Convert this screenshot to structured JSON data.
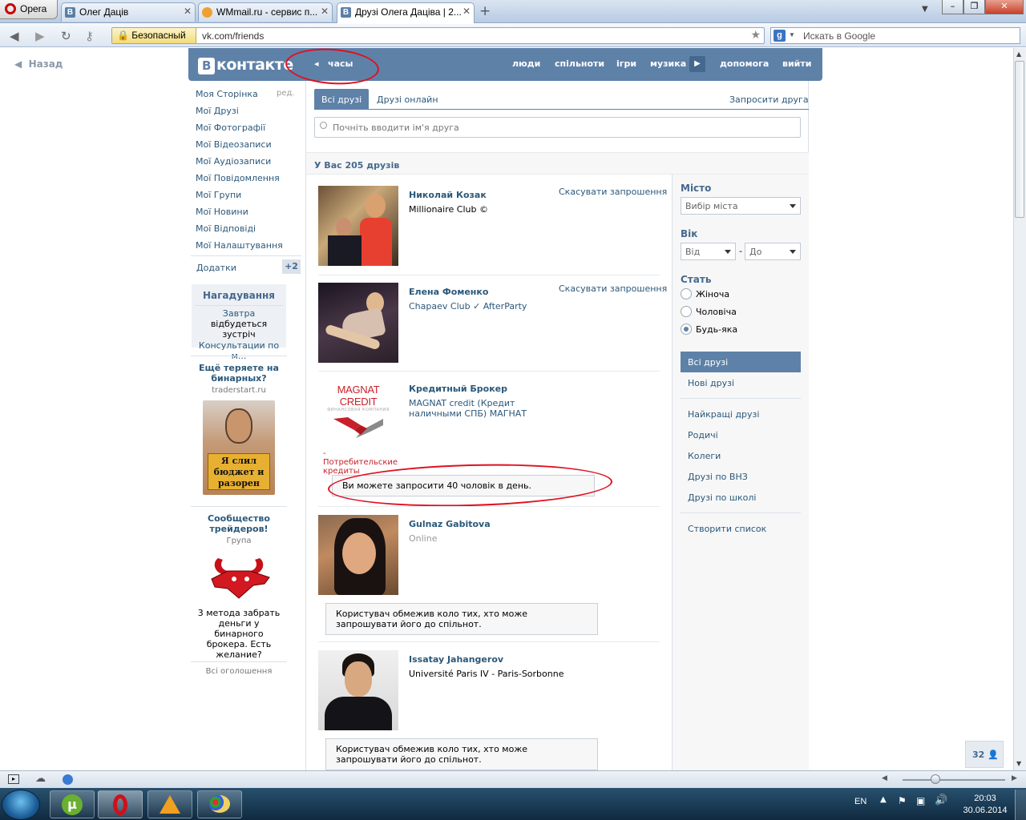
{
  "browser": {
    "menu_label": "Opera",
    "tabs": [
      {
        "label": "Олег Дацiв",
        "icon": "В"
      },
      {
        "label": "WMmail.ru - сервис п...",
        "icon": ""
      },
      {
        "label": "Друзi Олега Дацiва | 2...",
        "icon": "В"
      }
    ],
    "security_label": "Безопасный",
    "url": "vk.com/friends",
    "search_placeholder": "Искать в Google"
  },
  "page": {
    "back_label": "Назад",
    "logo_text": "контакте",
    "player_label": "часы",
    "nav": [
      "люди",
      "спiльноти",
      "iгри",
      "музика",
      "допомога",
      "вийти"
    ]
  },
  "left_menu": {
    "items": [
      "Моя Сторiнка",
      "Мої Друзi",
      "Мої Фотографiї",
      "Мої Вiдеозаписи",
      "Мої Аудiозаписи",
      "Мої Повiдомлення",
      "Мої Групи",
      "Мої Новини",
      "Мої Вiдповiдi",
      "Мої Налаштування"
    ],
    "edit_label": "ред.",
    "apps_label": "Додатки",
    "apps_count": "+2",
    "reminder": {
      "title": "Нагадування",
      "link": "Завтра",
      "text": "вiдбудеться зустрiч",
      "event": "Консультации по м..."
    },
    "ad1": {
      "title": "Ещё теряете на бинарных?",
      "source": "traderstart.ru",
      "sign": "Я слил бюджет и разорен"
    },
    "ad2": {
      "title": "Сообщество трейдеров!",
      "type": "Група",
      "text": "3 метода забрать деньги у бинарного брокера. Есть желание?"
    },
    "all_ads": "Всi оголошення"
  },
  "friends": {
    "tab_all": "Всi друзi",
    "tab_online": "Друзi онлайн",
    "invite": "Запросити друга",
    "search_placeholder": "Почнiть вводити iм'я друга",
    "count": "У Вас 205 друзiв",
    "cancel_label": "Скасувати запрошення",
    "list": [
      {
        "name": "Николай Козак",
        "sub": "Millionaire Club ©"
      },
      {
        "name": "Елена Фоменко",
        "sub": "Chapaev Club ✓ AfterParty"
      },
      {
        "name": "Кредитный Брокер",
        "sub": "MAGNAT credit (Кредит наличными СПБ) МАГНАТ",
        "logo": "MAGNAT CREDIT",
        "logo_sub": "ФИНАНСОВАЯ КОМПАНИЯ",
        "caption": "- Потребительские кредиты"
      },
      {
        "name": "Gulnaz Gabitova",
        "sub": "Online"
      },
      {
        "name": "Issatay Jahangerov",
        "sub": "Université Paris IV - Paris-Sorbonne"
      }
    ],
    "limit_notice": "Ви можете запросити 40 чоловiк в день.",
    "restricted_notice": "Користувач обмежив коло тих, хто може запрошувати його до спiльнот."
  },
  "filters": {
    "city_label": "Мiсто",
    "city_placeholder": "Вибiр мiста",
    "age_label": "Вiк",
    "age_from": "Вiд",
    "age_to": "До",
    "gender_label": "Стать",
    "genders": [
      "Жiноча",
      "Чоловiча",
      "Будь-яка"
    ],
    "selected_gender": "Будь-яка",
    "lists": [
      "Всi друзi",
      "Новi друзi",
      "Найкращi друзi",
      "Родичi",
      "Колеги",
      "Друзi по ВНЗ",
      "Друзi по школi",
      "Створити список"
    ]
  },
  "chat_count": "32",
  "taskbar": {
    "lang": "EN",
    "time": "20:03",
    "date": "30.06.2014"
  },
  "colors": {
    "vk_blue": "#5e81a8",
    "link": "#2b587a",
    "annotation": "#e01020"
  }
}
